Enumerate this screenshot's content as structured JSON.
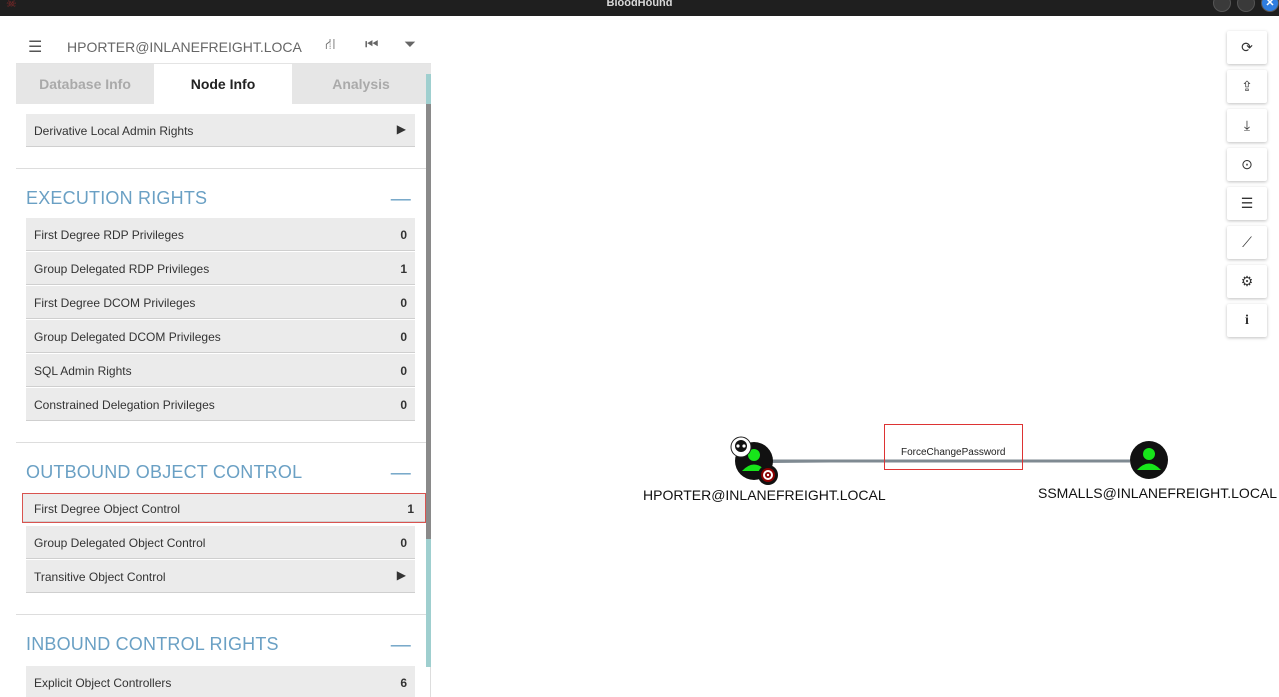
{
  "window": {
    "title": "BloodHound"
  },
  "search": {
    "query": "HPORTER@INLANEFREIGHT.LOCA"
  },
  "tabs": [
    {
      "label": "Database Info"
    },
    {
      "label": "Node Info"
    },
    {
      "label": "Analysis"
    }
  ],
  "rows_top": [
    {
      "label": "Derivative Local Admin Rights",
      "arrow": "▶"
    }
  ],
  "execution": {
    "title": "EXECUTION RIGHTS",
    "rows": [
      {
        "label": "First Degree RDP Privileges",
        "value": "0"
      },
      {
        "label": "Group Delegated RDP Privileges",
        "value": "1"
      },
      {
        "label": "First Degree DCOM Privileges",
        "value": "0"
      },
      {
        "label": "Group Delegated DCOM Privileges",
        "value": "0"
      },
      {
        "label": "SQL Admin Rights",
        "value": "0"
      },
      {
        "label": "Constrained Delegation Privileges",
        "value": "0"
      }
    ]
  },
  "outbound": {
    "title": "OUTBOUND OBJECT CONTROL",
    "rows": [
      {
        "label": "First Degree Object Control",
        "value": "1"
      },
      {
        "label": "Group Delegated Object Control",
        "value": "0"
      },
      {
        "label": "Transitive Object Control",
        "arrow": "▶"
      }
    ]
  },
  "inbound": {
    "title": "INBOUND CONTROL RIGHTS",
    "rows": [
      {
        "label": "Explicit Object Controllers",
        "value": "6"
      }
    ]
  },
  "toolbar": {
    "icons": [
      "refresh-icon",
      "upload-icon",
      "download-icon",
      "import-icon",
      "queue-icon",
      "chart-icon",
      "settings-icon",
      "info-icon"
    ],
    "glyphs": [
      "⟳",
      "⇪",
      "⤓",
      "⊙",
      "☰",
      "⟋",
      "⚙",
      "i"
    ]
  },
  "graph": {
    "source": "HPORTER@INLANEFREIGHT.LOCAL",
    "target": "SSMALLS@INLANEFREIGHT.LOCAL",
    "edge": "ForceChangePassword",
    "node_color": "#17e51a",
    "owned_badge_color": "#8b0000"
  }
}
